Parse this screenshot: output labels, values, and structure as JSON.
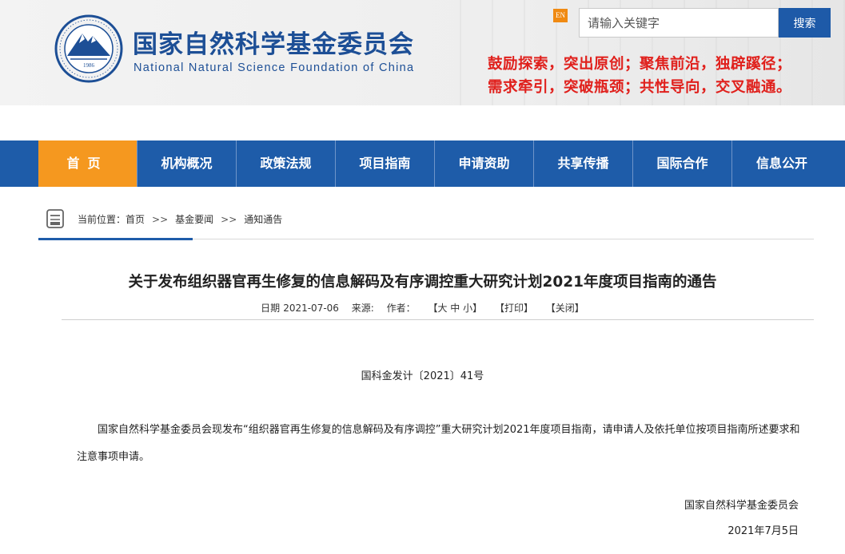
{
  "header": {
    "org_name_cn": "国家自然科学基金委员会",
    "org_name_en": "National Natural Science Foundation of China",
    "logo_year": "1986",
    "lang_badge": "EN",
    "search": {
      "placeholder": "请输入关键字",
      "button_label": "搜索"
    },
    "slogan_line1": "鼓励探索，突出原创；聚焦前沿，独辟蹊径；",
    "slogan_line2": "需求牵引，突破瓶颈；共性导向，交叉融通。"
  },
  "nav": {
    "items": [
      {
        "label": "首页",
        "active": true
      },
      {
        "label": "机构概况"
      },
      {
        "label": "政策法规"
      },
      {
        "label": "项目指南"
      },
      {
        "label": "申请资助"
      },
      {
        "label": "共享传播"
      },
      {
        "label": "国际合作"
      },
      {
        "label": "信息公开"
      }
    ]
  },
  "breadcrumb": {
    "prefix": "当前位置：",
    "items": [
      "首页",
      "基金要闻",
      "通知通告"
    ],
    "separator": ">>"
  },
  "article": {
    "title": "关于发布组织器官再生修复的信息解码及有序调控重大研究计划2021年度项目指南的通告",
    "meta": {
      "date_label": "日期",
      "date": "2021-07-06",
      "source_label": "来源:",
      "author_label": "作者：",
      "font_size_label": "【大 中 小】",
      "print_label": "【打印】",
      "close_label": "【关闭】"
    },
    "doc_number": "国科金发计〔2021〕41号",
    "body": "国家自然科学基金委员会现发布“组织器官再生修复的信息解码及有序调控”重大研究计划2021年度项目指南，请申请人及依托单位按项目指南所述要求和注意事项申请。",
    "signature": "国家自然科学基金委员会",
    "sign_date": "2021年7月5日"
  },
  "colors": {
    "nav_blue": "#1e5ca9",
    "active_orange": "#f5981f",
    "slogan_red": "#e0201c",
    "title_blue": "#1d4f96"
  }
}
